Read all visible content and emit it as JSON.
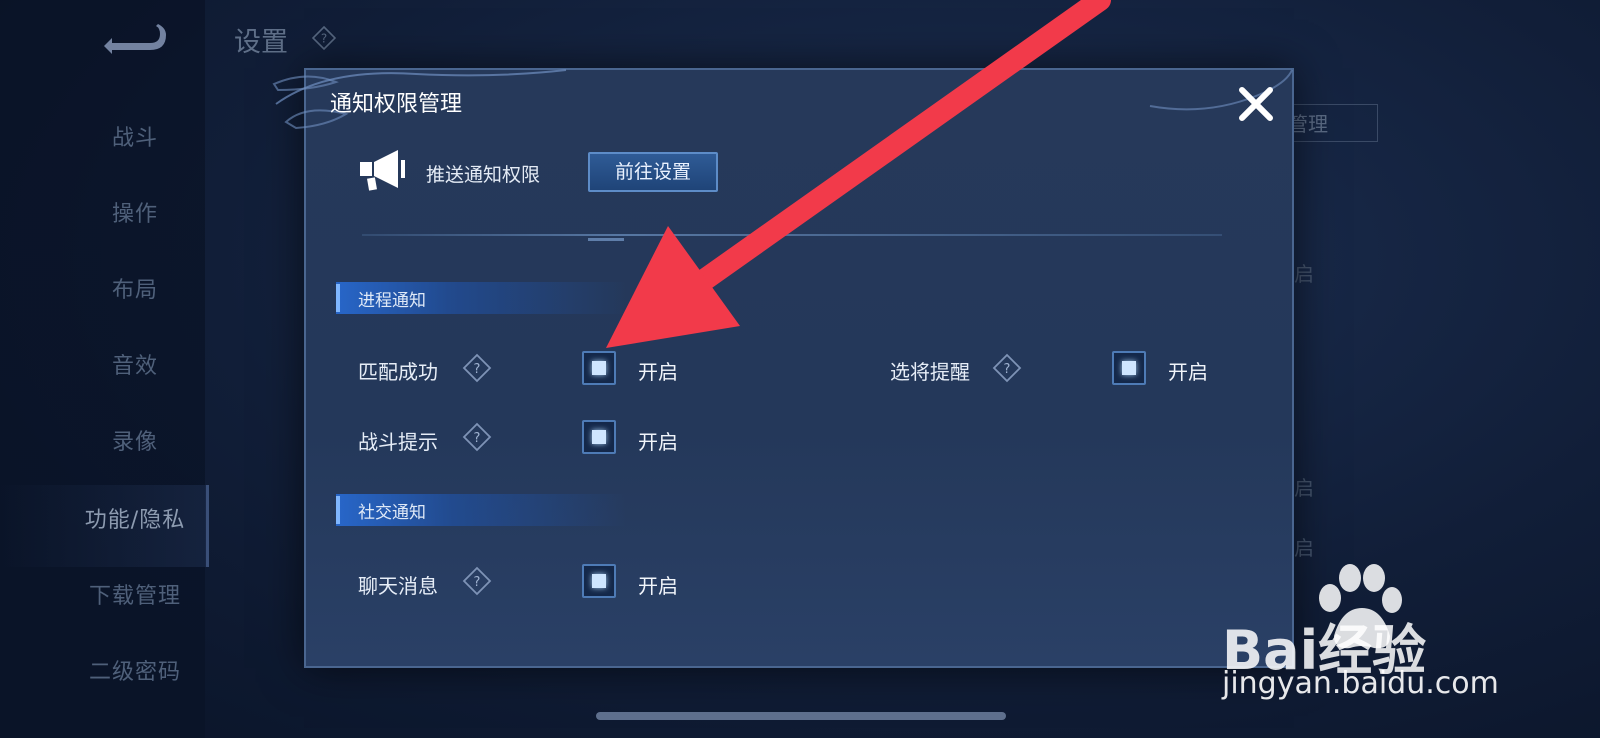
{
  "background": {
    "title": "设置",
    "nav": [
      "战斗",
      "操作",
      "布局",
      "音效",
      "录像",
      "功能/隐私",
      "下载管理",
      "二级密码"
    ],
    "active_nav": "功能/隐私",
    "right_button_partial": "权管理",
    "right_texts": [
      "启",
      "启",
      "启"
    ]
  },
  "modal": {
    "title": "通知权限管理",
    "push_label": "推送通知权限",
    "goto_button": "前往设置",
    "sections": [
      {
        "title": "进程通知",
        "options": [
          {
            "label": "匹配成功",
            "state": "开启",
            "checked": true
          },
          {
            "label": "选将提醒",
            "state": "开启",
            "checked": true
          },
          {
            "label": "战斗提示",
            "state": "开启",
            "checked": true
          }
        ]
      },
      {
        "title": "社交通知",
        "options": [
          {
            "label": "聊天消息",
            "state": "开启",
            "checked": true
          }
        ]
      }
    ]
  },
  "icons": {
    "back": "back-arrow-icon",
    "close": "close-icon",
    "help": "question-diamond-icon",
    "push": "megaphone-icon"
  },
  "watermark": {
    "logo": "Bai经验",
    "url": "jingyan.baidu.com"
  },
  "colors": {
    "accent": "#4e7bb6",
    "arrow": "#f23a4a",
    "modal_bg": "#26395a"
  }
}
